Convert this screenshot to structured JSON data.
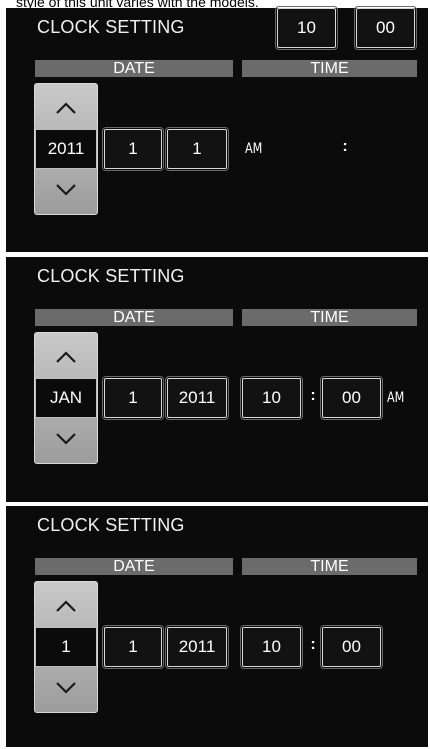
{
  "caption": "style of this unit varies with the models.",
  "panels": [
    {
      "title": "CLOCK SETTING",
      "date_header": "DATE",
      "time_header": "TIME",
      "selected_value": "2011",
      "date_fields": [
        "1",
        "1"
      ],
      "ampm": "AM",
      "hour": "10",
      "colon": ":",
      "minute": "00"
    },
    {
      "title": "CLOCK SETTING",
      "date_header": "DATE",
      "time_header": "TIME",
      "selected_value": "JAN",
      "date_fields": [
        "1",
        "2011"
      ],
      "hour": "10",
      "colon": ":",
      "minute": "00",
      "ampm": "AM"
    },
    {
      "title": "CLOCK SETTING",
      "date_header": "DATE",
      "time_header": "TIME",
      "selected_value": "1",
      "date_fields": [
        "1",
        "2011"
      ],
      "hour": "10",
      "colon": ":",
      "minute": "00"
    }
  ],
  "icons": {
    "up": "chevron-up-icon",
    "down": "chevron-down-icon"
  },
  "colors": {
    "panel_bg": "#0b0b0b",
    "header_bar": "#6b6b6b",
    "spinner": "#b5b5b5",
    "text": "#ffffff"
  }
}
